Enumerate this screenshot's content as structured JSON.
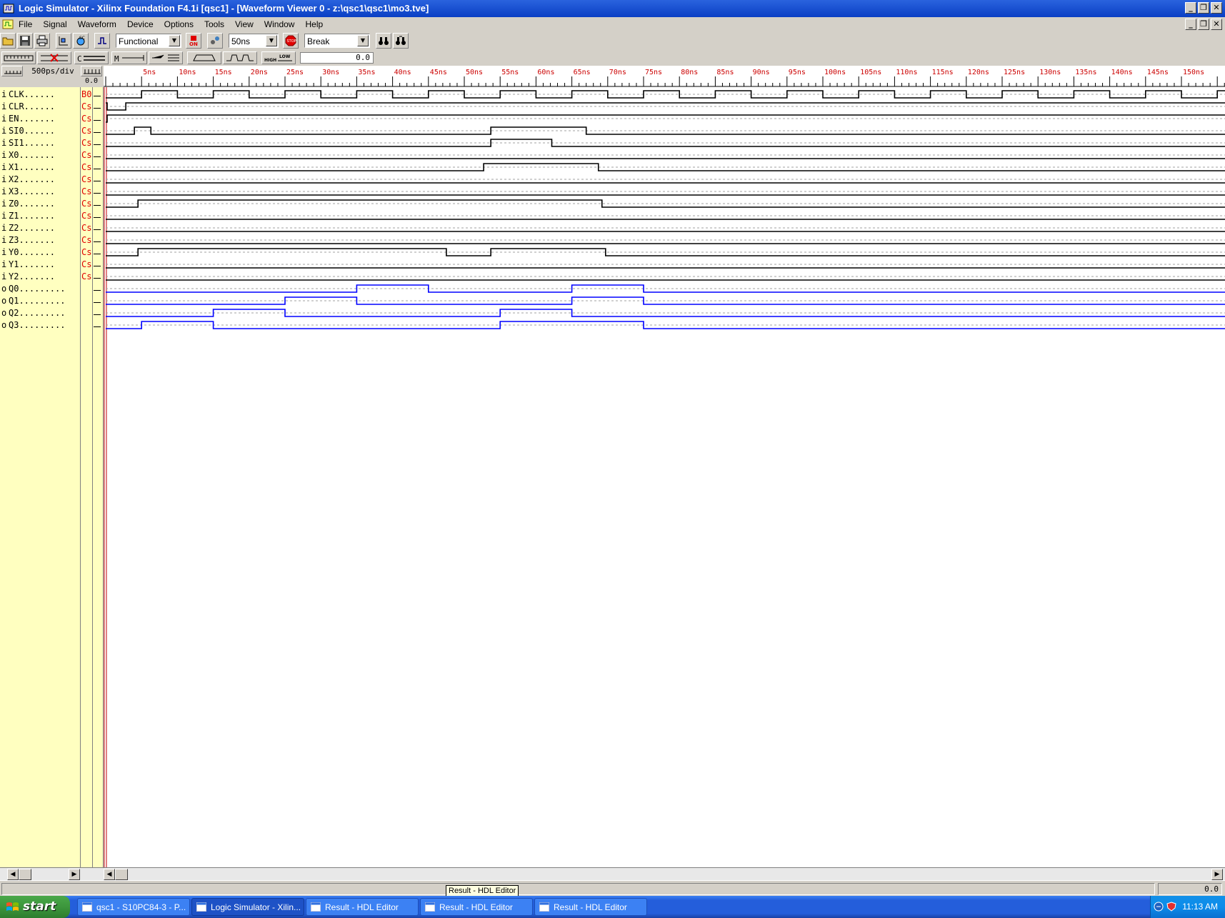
{
  "window": {
    "title": "Logic Simulator - Xilinx Foundation F4.1i [qsc1] - [Waveform Viewer 0  -  z:\\qsc1\\qsc1\\mo3.tve]"
  },
  "menu": [
    "File",
    "Signal",
    "Waveform",
    "Device",
    "Options",
    "Tools",
    "View",
    "Window",
    "Help"
  ],
  "toolbar": {
    "mode": "Functional",
    "step": "50ns",
    "break": "Break",
    "cursor_value": "0.0"
  },
  "zoom": "500ps/div",
  "time_origin": "0.0",
  "ruler_labels": [
    "5ns",
    "10ns",
    "15ns",
    "20ns",
    "25ns",
    "30ns",
    "35ns",
    "40ns",
    "45ns",
    "50ns",
    "55ns",
    "60ns",
    "65ns",
    "70ns",
    "75ns",
    "80ns",
    "85ns",
    "90ns",
    "95ns",
    "100ns",
    "105ns",
    "110ns",
    "115ns",
    "120ns",
    "125ns",
    "130ns",
    "135ns",
    "140ns",
    "145ns",
    "150ns"
  ],
  "signals": [
    {
      "dir": "i",
      "name": "CLK......",
      "src": "B0",
      "color": "#000000"
    },
    {
      "dir": "i",
      "name": "CLR......",
      "src": "Cs",
      "color": "#000000"
    },
    {
      "dir": "i",
      "name": "EN.......",
      "src": "Cs",
      "color": "#000000"
    },
    {
      "dir": "i",
      "name": "SI0......",
      "src": "Cs",
      "color": "#000000"
    },
    {
      "dir": "i",
      "name": "SI1......",
      "src": "Cs",
      "color": "#000000"
    },
    {
      "dir": "i",
      "name": "X0.......",
      "src": "Cs",
      "color": "#000000"
    },
    {
      "dir": "i",
      "name": "X1.......",
      "src": "Cs",
      "color": "#000000"
    },
    {
      "dir": "i",
      "name": "X2.......",
      "src": "Cs",
      "color": "#000000"
    },
    {
      "dir": "i",
      "name": "X3.......",
      "src": "Cs",
      "color": "#000000"
    },
    {
      "dir": "i",
      "name": "Z0.......",
      "src": "Cs",
      "color": "#000000"
    },
    {
      "dir": "i",
      "name": "Z1.......",
      "src": "Cs",
      "color": "#000000"
    },
    {
      "dir": "i",
      "name": "Z2.......",
      "src": "Cs",
      "color": "#000000"
    },
    {
      "dir": "i",
      "name": "Z3.......",
      "src": "Cs",
      "color": "#000000"
    },
    {
      "dir": "i",
      "name": "Y0.......",
      "src": "Cs",
      "color": "#000000"
    },
    {
      "dir": "i",
      "name": "Y1.......",
      "src": "Cs",
      "color": "#000000"
    },
    {
      "dir": "i",
      "name": "Y2.......",
      "src": "Cs",
      "color": "#000000"
    },
    {
      "dir": "o",
      "name": "Q0.........",
      "src": "",
      "color": "#0000ff"
    },
    {
      "dir": "o",
      "name": "Q1.........",
      "src": "",
      "color": "#0000ff"
    },
    {
      "dir": "o",
      "name": "Q2.........",
      "src": "",
      "color": "#0000ff"
    },
    {
      "dir": "o",
      "name": "Q3.........",
      "src": "",
      "color": "#0000ff"
    }
  ],
  "statusbar": {
    "tooltip": "Result - HDL Editor",
    "value": "0.0"
  },
  "taskbar": {
    "start": "start",
    "tasks": [
      "qsc1 - S10PC84-3 - P...",
      "Logic Simulator - Xilin...",
      "Result - HDL Editor",
      "Result - HDL Editor",
      "Result - HDL Editor"
    ],
    "clock": "11:13 AM"
  },
  "colors": {
    "ruler_text": "#cc0000",
    "signal_panel": "#ffffc0",
    "output_wave": "#0000ff",
    "input_wave": "#000000"
  }
}
